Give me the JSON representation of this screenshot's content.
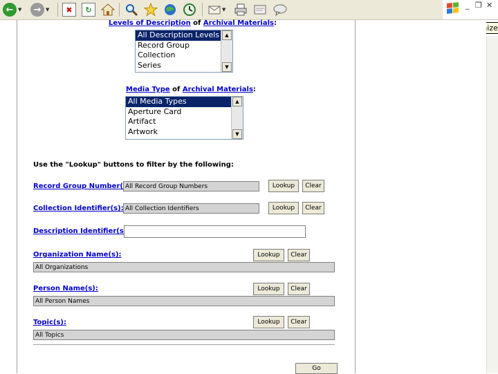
{
  "window": {
    "tooltip": "Minimize"
  },
  "toolbar": {
    "icons": [
      "back-icon",
      "forward-icon",
      "stop-icon",
      "refresh-icon",
      "home-icon",
      "search-icon",
      "favorites-icon",
      "media-icon",
      "history-icon",
      "mail-icon",
      "print-icon",
      "edit-icon",
      "discuss-icon"
    ]
  },
  "levels": {
    "link1": "Levels of Description",
    "of": " of ",
    "link2": "Archival Materials",
    "colon": ":",
    "options": [
      "All Description Levels",
      "Record Group",
      "Collection",
      "Series"
    ]
  },
  "media": {
    "link1": "Media Type",
    "of": " of ",
    "link2": "Archival Materials",
    "colon": ":",
    "options": [
      "All Media Types",
      "Aperture Card",
      "Artifact",
      "Artwork"
    ]
  },
  "lookup_instructions": "Use the \"Lookup\" buttons to filter by the following:",
  "filters": {
    "record_group": {
      "label": "Record Group Number(s):",
      "value": "All Record Group Numbers",
      "lookup": "Lookup",
      "clear": "Clear"
    },
    "collection": {
      "label": "Collection Identifier(s):",
      "value": "All Collection Identifiers",
      "lookup": "Lookup",
      "clear": "Clear"
    },
    "description": {
      "label": "Description Identifier(s):",
      "value": ""
    },
    "organization": {
      "label": "Organization Name(s):",
      "value": "All Organizations",
      "lookup": "Lookup",
      "clear": "Clear"
    },
    "person": {
      "label": "Person Name(s):",
      "value": "All Person Names",
      "lookup": "Lookup",
      "clear": "Clear"
    },
    "topic": {
      "label": "Topic(s):",
      "value": "All Topics",
      "lookup": "Lookup",
      "clear": "Clear"
    }
  },
  "go_button": "Go"
}
